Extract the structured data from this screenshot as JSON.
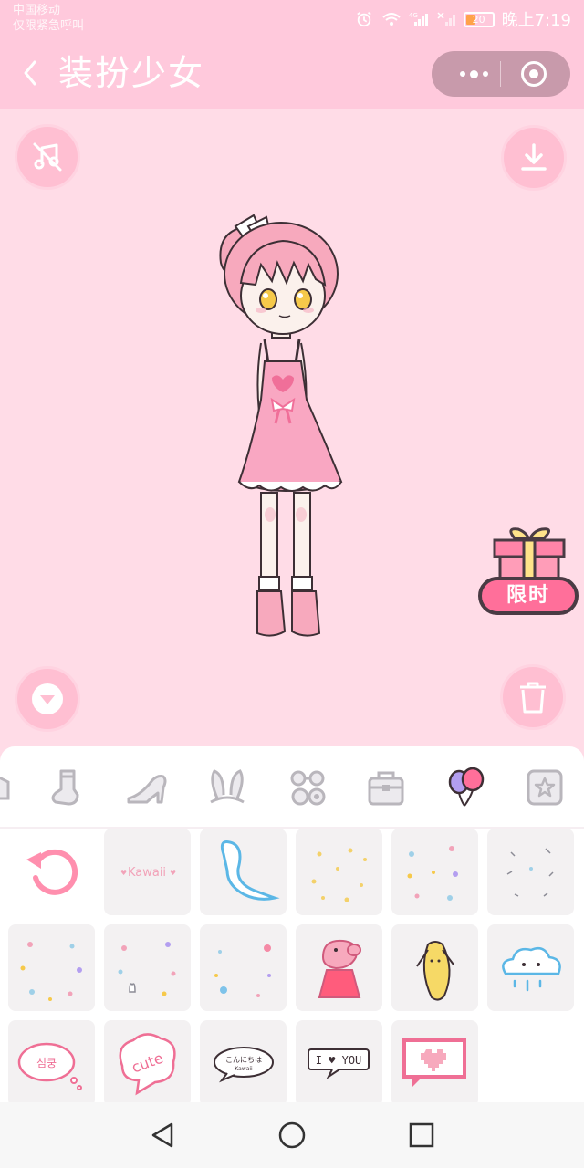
{
  "status_bar": {
    "carrier_line1": "中国移动",
    "carrier_line2": "仅限紧急呼叫",
    "network_label": "4G",
    "battery": "20",
    "time": "晚上7:19"
  },
  "nav": {
    "title": "装扮少女"
  },
  "controls": {
    "music_toggle": "music-off-icon",
    "download": "download-icon",
    "collapse": "chevron-down-icon",
    "delete": "trash-icon"
  },
  "promo": {
    "label": "限时"
  },
  "tabs": [
    {
      "icon": "clothing-partial-icon"
    },
    {
      "icon": "sock-icon"
    },
    {
      "icon": "high-heel-icon"
    },
    {
      "icon": "bunny-ears-icon"
    },
    {
      "icon": "glasses-flower-icon"
    },
    {
      "icon": "bag-icon"
    },
    {
      "icon": "balloon-icon",
      "selected": true
    },
    {
      "icon": "star-frame-icon"
    }
  ],
  "stickers": {
    "reset": "reset-icon",
    "kawaii_text": "Kawaii",
    "speech_korean": "심쿵",
    "speech_cute": "cute",
    "speech_japanese": "こんにちは",
    "speech_japanese_sub": "Kawaii",
    "love_text": "I ♥ YOU"
  },
  "colors": {
    "accent": "#ff6f9a",
    "status_bg": "#ffc9dc",
    "canvas_bg": "#ffdce7",
    "button_bg": "#ffbfd2"
  }
}
